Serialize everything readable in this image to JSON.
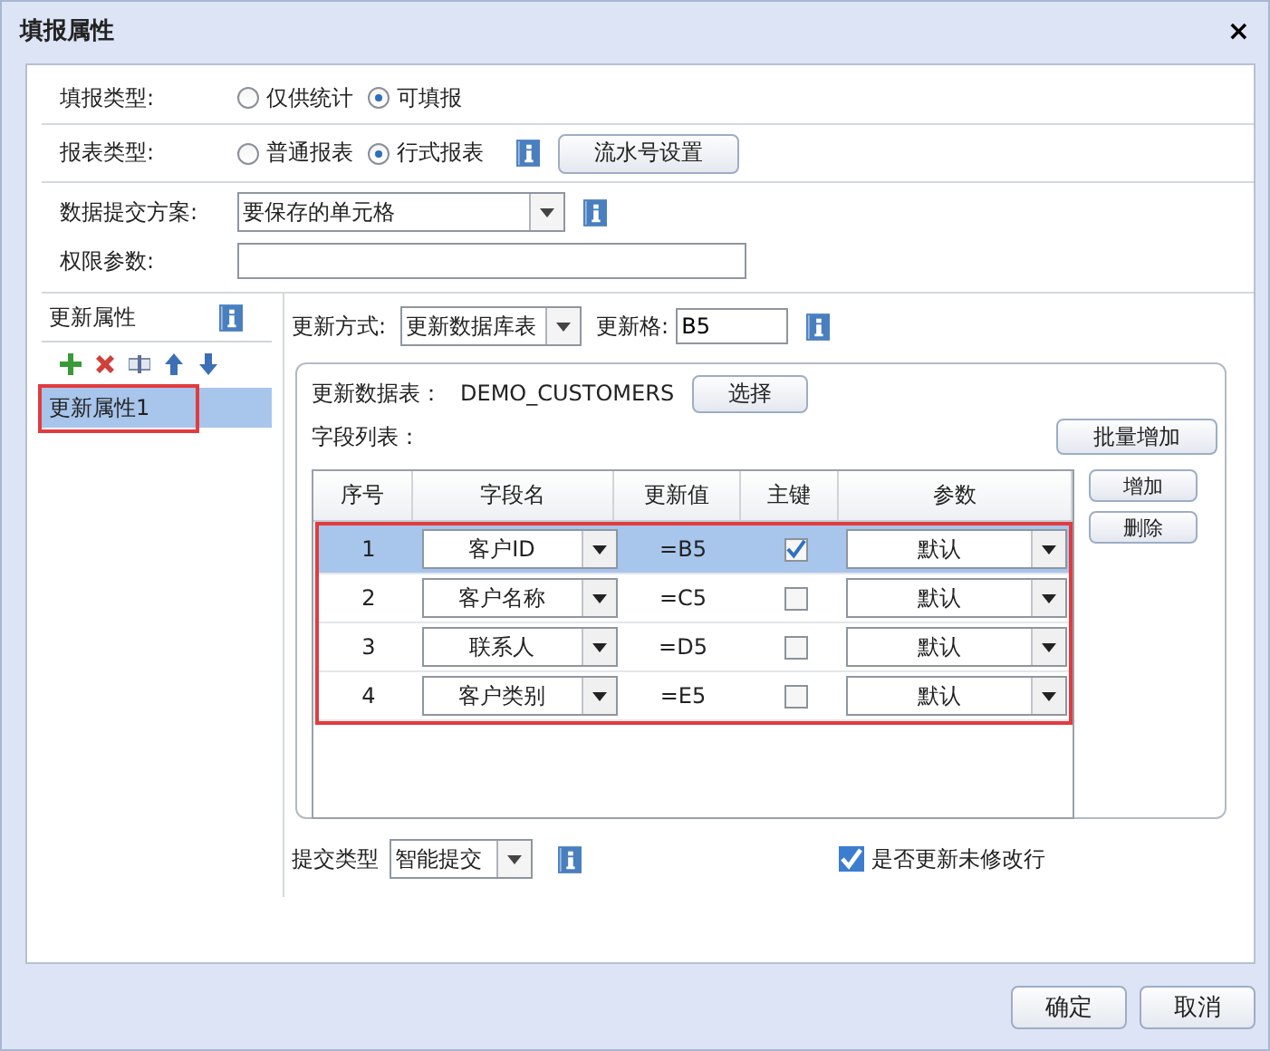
{
  "window": {
    "title": "填报属性",
    "close": "×"
  },
  "fill_type": {
    "label": "填报类型:",
    "options": [
      {
        "label": "仅供统计",
        "selected": false
      },
      {
        "label": "可填报",
        "selected": true
      }
    ]
  },
  "report_type": {
    "label": "报表类型:",
    "options": [
      {
        "label": "普通报表",
        "selected": false
      },
      {
        "label": "行式报表",
        "selected": true
      }
    ],
    "button": "流水号设置"
  },
  "submit_scheme": {
    "label": "数据提交方案:",
    "value": "要保存的单元格"
  },
  "permission": {
    "label": "权限参数:"
  },
  "update_props": {
    "title": "更新属性",
    "items": [
      {
        "label": "更新属性1",
        "selected": true
      }
    ]
  },
  "update_mode": {
    "label": "更新方式:",
    "value": "更新数据库表"
  },
  "update_cell": {
    "label": "更新格:",
    "value": "B5"
  },
  "table_name": {
    "label": "更新数据表：",
    "value": "DEMO_CUSTOMERS",
    "button": "选择"
  },
  "field_list": {
    "label": "字段列表：",
    "batch_button": "批量增加",
    "add_button": "增加",
    "delete_button": "删除",
    "columns": [
      "序号",
      "字段名",
      "更新值",
      "主键",
      "参数"
    ],
    "rows": [
      {
        "index": "1",
        "field": "客户ID",
        "value": "=B5",
        "key": true,
        "param": "默认",
        "selected": true
      },
      {
        "index": "2",
        "field": "客户名称",
        "value": "=C5",
        "key": false,
        "param": "默认",
        "selected": false
      },
      {
        "index": "3",
        "field": "联系人",
        "value": "=D5",
        "key": false,
        "param": "默认",
        "selected": false
      },
      {
        "index": "4",
        "field": "客户类别",
        "value": "=E5",
        "key": false,
        "param": "默认",
        "selected": false
      }
    ]
  },
  "submit_type": {
    "label": "提交类型",
    "value": "智能提交"
  },
  "update_unmodified": {
    "label": "是否更新未修改行",
    "checked": true
  },
  "buttons": [
    "确定",
    "取消"
  ]
}
